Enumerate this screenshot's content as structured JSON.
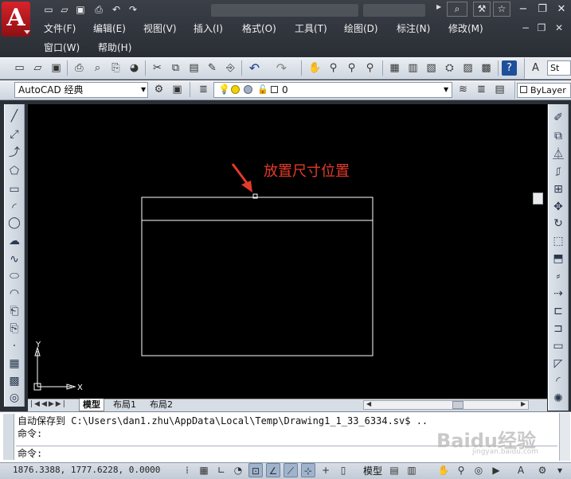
{
  "app": {
    "menu": [
      "文件(F)",
      "编辑(E)",
      "视图(V)",
      "插入(I)",
      "格式(O)",
      "工具(T)",
      "绘图(D)",
      "标注(N)",
      "修改(M)",
      "窗口(W)",
      "帮助(H)"
    ]
  },
  "toolbar": {
    "workspace": "AutoCAD 经典",
    "layer_name": "0",
    "color": "ByLayer",
    "text_style_partial": "St"
  },
  "drawing": {
    "annotation": "放置尺寸位置"
  },
  "axes": {
    "x": "X",
    "y": "Y"
  },
  "tabs": [
    "模型",
    "布局1",
    "布局2"
  ],
  "command": {
    "autosave_line": "自动保存到 C:\\Users\\dan1.zhu\\AppData\\Local\\Temp\\Drawing1_1_33_6334.sv$ ..",
    "prompt1": "命令:",
    "prompt2": "命令:"
  },
  "status": {
    "coordinates": "1876.3388, 1777.6228, 0.0000",
    "space": "模型"
  },
  "watermark": {
    "text": "Baidu经验",
    "sub": "jingyan.baidu.com"
  },
  "colors": {
    "canvas_background": "#000000",
    "annotation_red": "#e53a2a",
    "app_red": "#d8232a"
  },
  "icons": {
    "window_close": "close-icon",
    "window_minimize": "minimize-icon",
    "window_restore": "restore-icon"
  }
}
